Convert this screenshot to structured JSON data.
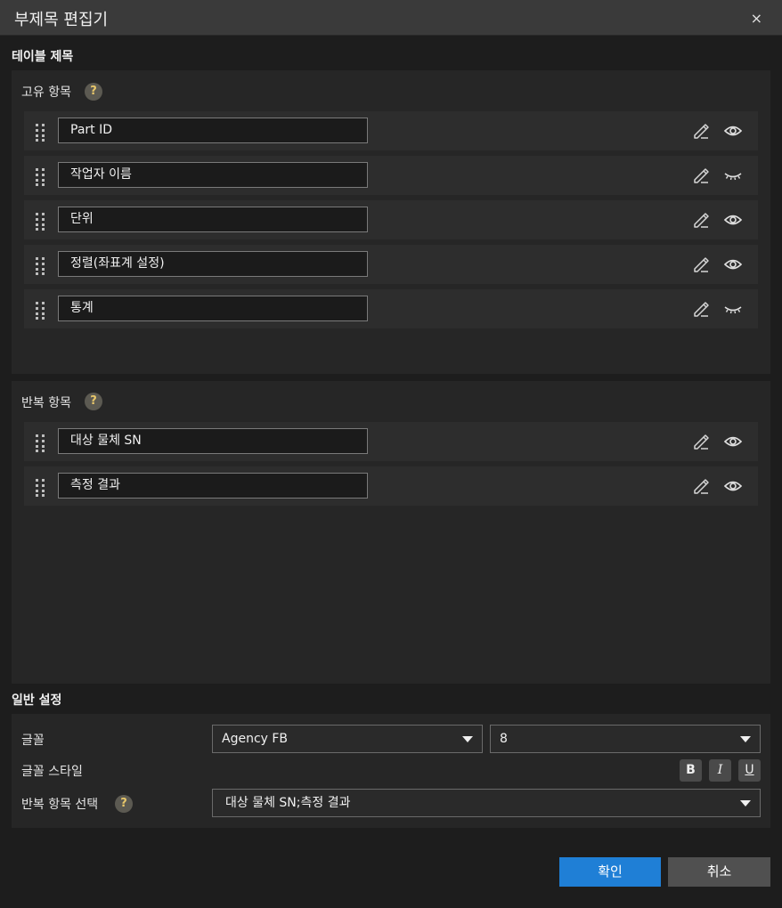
{
  "window": {
    "title": "부제목 편집기",
    "close_symbol": "×"
  },
  "table_title": {
    "heading": "테이블 제목"
  },
  "fixed_items": {
    "label": "고유 항목",
    "help": "?",
    "items": [
      {
        "label": "Part ID",
        "visible": true
      },
      {
        "label": "작업자 이름",
        "visible": false
      },
      {
        "label": "단위",
        "visible": true
      },
      {
        "label": "정렬(좌표계 설정)",
        "visible": true
      },
      {
        "label": "통계",
        "visible": false
      }
    ]
  },
  "repeat_items": {
    "label": "반복 항목",
    "help": "?",
    "items": [
      {
        "label": "대상 물체 SN",
        "visible": true
      },
      {
        "label": "측정 결과",
        "visible": true
      }
    ]
  },
  "general_settings": {
    "heading": "일반 설정",
    "font_label": "글꼴",
    "font_value": "Agency FB",
    "size_value": "8",
    "style_label": "글꼴 스타일",
    "bold": "B",
    "italic": "I",
    "underline": "U",
    "repeat_select_label": "반복 항목 선택",
    "repeat_help": "?",
    "repeat_select_value": "대상 물체 SN;측정 결과"
  },
  "buttons": {
    "ok": "확인",
    "cancel": "취소"
  },
  "colors": {
    "accent": "#1f7fd6",
    "background": "#1d1d1d",
    "panel": "#262626",
    "row": "#2d2d2d"
  },
  "icons": {
    "edit": "pencil-edit-icon",
    "visible": "eye-icon",
    "hidden": "eye-closed-icon",
    "drag": "drag-handle-icon"
  }
}
